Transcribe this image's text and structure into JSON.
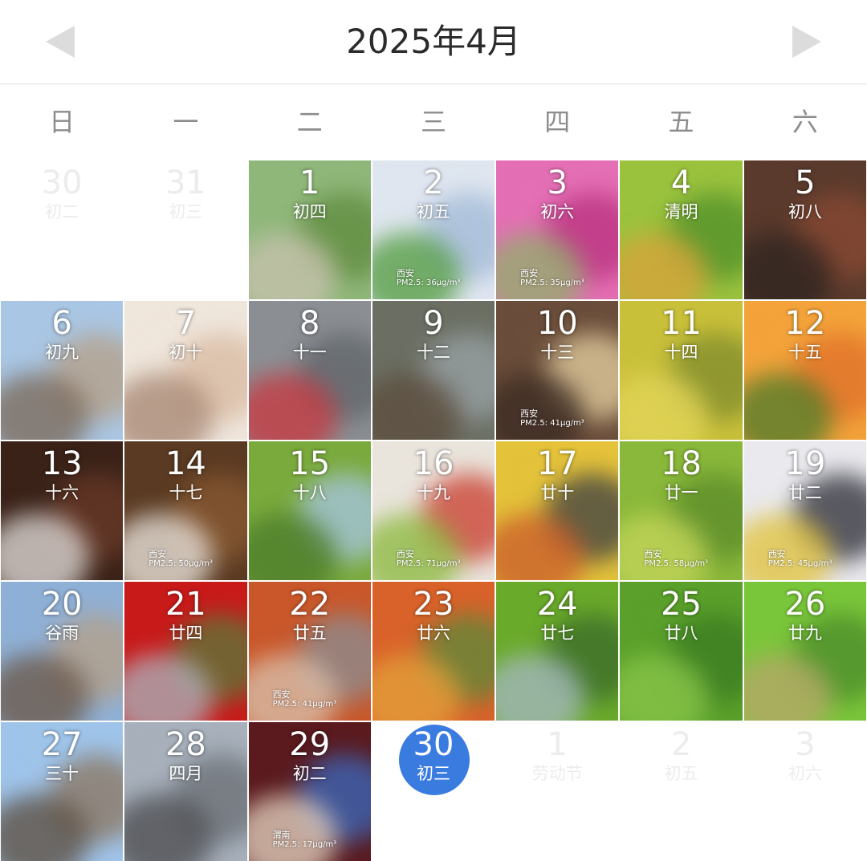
{
  "header": {
    "title": "2025年4月",
    "prev_icon": "triangle-left",
    "next_icon": "triangle-right"
  },
  "weekdays": [
    "日",
    "一",
    "二",
    "三",
    "四",
    "五",
    "六"
  ],
  "days": [
    {
      "day": "30",
      "lunar": "初二",
      "outside": true
    },
    {
      "day": "31",
      "lunar": "初三",
      "outside": true
    },
    {
      "day": "1",
      "lunar": "初四",
      "bg": [
        "#8fb77a",
        "#5d8a3c",
        "#c9c2b0"
      ]
    },
    {
      "day": "2",
      "lunar": "初五",
      "bg": [
        "#dfe6ef",
        "#9fb8d6",
        "#4f9a3c"
      ],
      "wm": {
        "city": "西安",
        "pm": "PM2.5: 36μg/m³"
      }
    },
    {
      "day": "3",
      "lunar": "初六",
      "bg": [
        "#e46fb4",
        "#b9307e",
        "#8fb06a"
      ],
      "wm": {
        "city": "西安",
        "pm": "PM2.5: 35μg/m³"
      }
    },
    {
      "day": "4",
      "lunar": "清明",
      "bg": [
        "#9ac23d",
        "#4f8f2a",
        "#d9a23a"
      ]
    },
    {
      "day": "5",
      "lunar": "初八",
      "bg": [
        "#5a3a2c",
        "#8a4a34",
        "#2e2420"
      ]
    },
    {
      "day": "6",
      "lunar": "初九",
      "bg": [
        "#a9c6e4",
        "#b69f85",
        "#7a6654"
      ]
    },
    {
      "day": "7",
      "lunar": "初十",
      "bg": [
        "#efe6dc",
        "#d8b9a0",
        "#a58470"
      ]
    },
    {
      "day": "8",
      "lunar": "十一",
      "bg": [
        "#8b8f94",
        "#5f6469",
        "#c9363e"
      ]
    },
    {
      "day": "9",
      "lunar": "十二",
      "bg": [
        "#6b6f63",
        "#9aa4a8",
        "#5c4c3c"
      ]
    },
    {
      "day": "10",
      "lunar": "十三",
      "bg": [
        "#6a4d3a",
        "#e8d2a2",
        "#3a2a22"
      ],
      "wm": {
        "city": "西安",
        "pm": "PM2.5: 41μg/m³"
      }
    },
    {
      "day": "11",
      "lunar": "十四",
      "bg": [
        "#c9c03a",
        "#7d8a2c",
        "#e4d65a"
      ]
    },
    {
      "day": "12",
      "lunar": "十五",
      "bg": [
        "#f3a33a",
        "#e06f2a",
        "#4b7a2a"
      ]
    },
    {
      "day": "13",
      "lunar": "十六",
      "bg": [
        "#3a2218",
        "#6a3a28",
        "#e6e2e0"
      ]
    },
    {
      "day": "14",
      "lunar": "十七",
      "bg": [
        "#5a3a22",
        "#8a5a32",
        "#f0ebe4"
      ],
      "wm": {
        "city": "西安",
        "pm": "PM2.5: 50μg/m³"
      }
    },
    {
      "day": "15",
      "lunar": "十八",
      "bg": [
        "#7aaa3c",
        "#a7c6e6",
        "#4a7a2a"
      ]
    },
    {
      "day": "16",
      "lunar": "十九",
      "bg": [
        "#e9e4dc",
        "#c93a2a",
        "#8ab83a"
      ],
      "wm": {
        "city": "西安",
        "pm": "PM2.5: 71μg/m³"
      }
    },
    {
      "day": "17",
      "lunar": "廿十",
      "bg": [
        "#e4c23a",
        "#3a3e44",
        "#c95a2a"
      ]
    },
    {
      "day": "18",
      "lunar": "廿一",
      "bg": [
        "#8ab83a",
        "#5a8a2a",
        "#c6d65a"
      ],
      "wm": {
        "city": "西安",
        "pm": "PM2.5: 58μg/m³"
      }
    },
    {
      "day": "19",
      "lunar": "廿二",
      "bg": [
        "#e9e9ee",
        "#2a2a34",
        "#e0c23a"
      ],
      "wm": {
        "city": "西安",
        "pm": "PM2.5: 45μg/m³"
      }
    },
    {
      "day": "20",
      "lunar": "谷雨",
      "bg": [
        "#8fb0d6",
        "#b69f85",
        "#6a5442"
      ]
    },
    {
      "day": "21",
      "lunar": "廿四",
      "bg": [
        "#c91a1a",
        "#5a7a3a",
        "#aab6c0"
      ]
    },
    {
      "day": "22",
      "lunar": "廿五",
      "bg": [
        "#c9572a",
        "#8a8e94",
        "#d9c4b0"
      ],
      "wm": {
        "city": "西安",
        "pm": "PM2.5: 41μg/m³"
      }
    },
    {
      "day": "23",
      "lunar": "廿六",
      "bg": [
        "#d9622a",
        "#5a8a3a",
        "#e4a23a"
      ]
    },
    {
      "day": "24",
      "lunar": "廿七",
      "bg": [
        "#6aaa2a",
        "#3a6a2a",
        "#a6b8c6"
      ]
    },
    {
      "day": "25",
      "lunar": "廿八",
      "bg": [
        "#5aa02a",
        "#3a7a22",
        "#8ac64a"
      ]
    },
    {
      "day": "26",
      "lunar": "廿九",
      "bg": [
        "#7ac63a",
        "#4a8a2a",
        "#b8a66a"
      ]
    },
    {
      "day": "27",
      "lunar": "三十",
      "bg": [
        "#9fc4ea",
        "#8a735c",
        "#5a4a3a"
      ]
    },
    {
      "day": "28",
      "lunar": "四月",
      "bg": [
        "#a7b0bb",
        "#6a6e74",
        "#4a4a4e"
      ]
    },
    {
      "day": "29",
      "lunar": "初二",
      "bg": [
        "#5a1a1e",
        "#3a6ac0",
        "#e8d8c4"
      ],
      "wm": {
        "city": "渭南",
        "pm": "PM2.5: 17μg/m³"
      }
    },
    {
      "day": "30",
      "lunar": "初三",
      "today": true
    },
    {
      "day": "1",
      "lunar": "劳动节",
      "outside": true
    },
    {
      "day": "2",
      "lunar": "初五",
      "outside": true
    },
    {
      "day": "3",
      "lunar": "初六",
      "outside": true
    }
  ]
}
